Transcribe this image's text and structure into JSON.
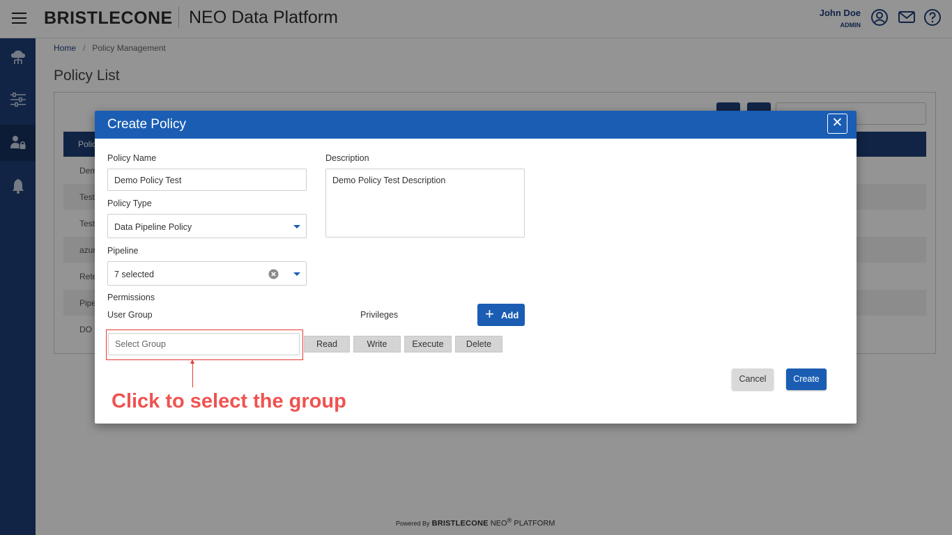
{
  "header": {
    "brand": "BRISTLECONE",
    "app_title": "NEO Data Platform",
    "user_name": "John Doe",
    "user_role": "ADMIN",
    "icons": [
      "account-circle-icon",
      "mail-icon",
      "help-icon"
    ]
  },
  "sidebar": {
    "items": [
      {
        "icon": "cloud-network-icon",
        "active": false
      },
      {
        "icon": "sliders-icon",
        "active": false
      },
      {
        "icon": "user-lock-icon",
        "active": true
      },
      {
        "icon": "bell-icon",
        "active": false
      }
    ]
  },
  "breadcrumb": {
    "home": "Home",
    "separator": "/",
    "current": "Policy Management"
  },
  "page": {
    "title": "Policy List",
    "table_header": "Polic",
    "rows": [
      "Dem",
      "Test",
      "Test",
      "azur",
      "Rete",
      "Pipe",
      "DO F"
    ]
  },
  "modal": {
    "title": "Create Policy",
    "close_label": "✕",
    "policy_name_label": "Policy Name",
    "policy_name_value": "Demo Policy Test",
    "description_label": "Description",
    "description_value": "Demo Policy Test Description",
    "policy_type_label": "Policy Type",
    "policy_type_value": "Data Pipeline Policy",
    "pipeline_label": "Pipeline",
    "pipeline_value": "7 selected",
    "permissions_label": "Permissions",
    "user_group_label": "User Group",
    "privileges_label": "Privileges",
    "add_label": "Add",
    "select_group_placeholder": "Select Group",
    "privileges": [
      "Read",
      "Write",
      "Execute",
      "Delete"
    ],
    "cancel_label": "Cancel",
    "create_label": "Create"
  },
  "annotation": {
    "text": "Click to select the group",
    "color": "#ef5350"
  },
  "footer": {
    "powered_by": "Powered By",
    "brand": "BRISTLECONE",
    "product": "NEO",
    "reg": "®",
    "platform": "PLATFORM"
  },
  "colors": {
    "primary": "#1a5db3",
    "sidebar": "#1e3f77",
    "annotation": "#e53935"
  }
}
